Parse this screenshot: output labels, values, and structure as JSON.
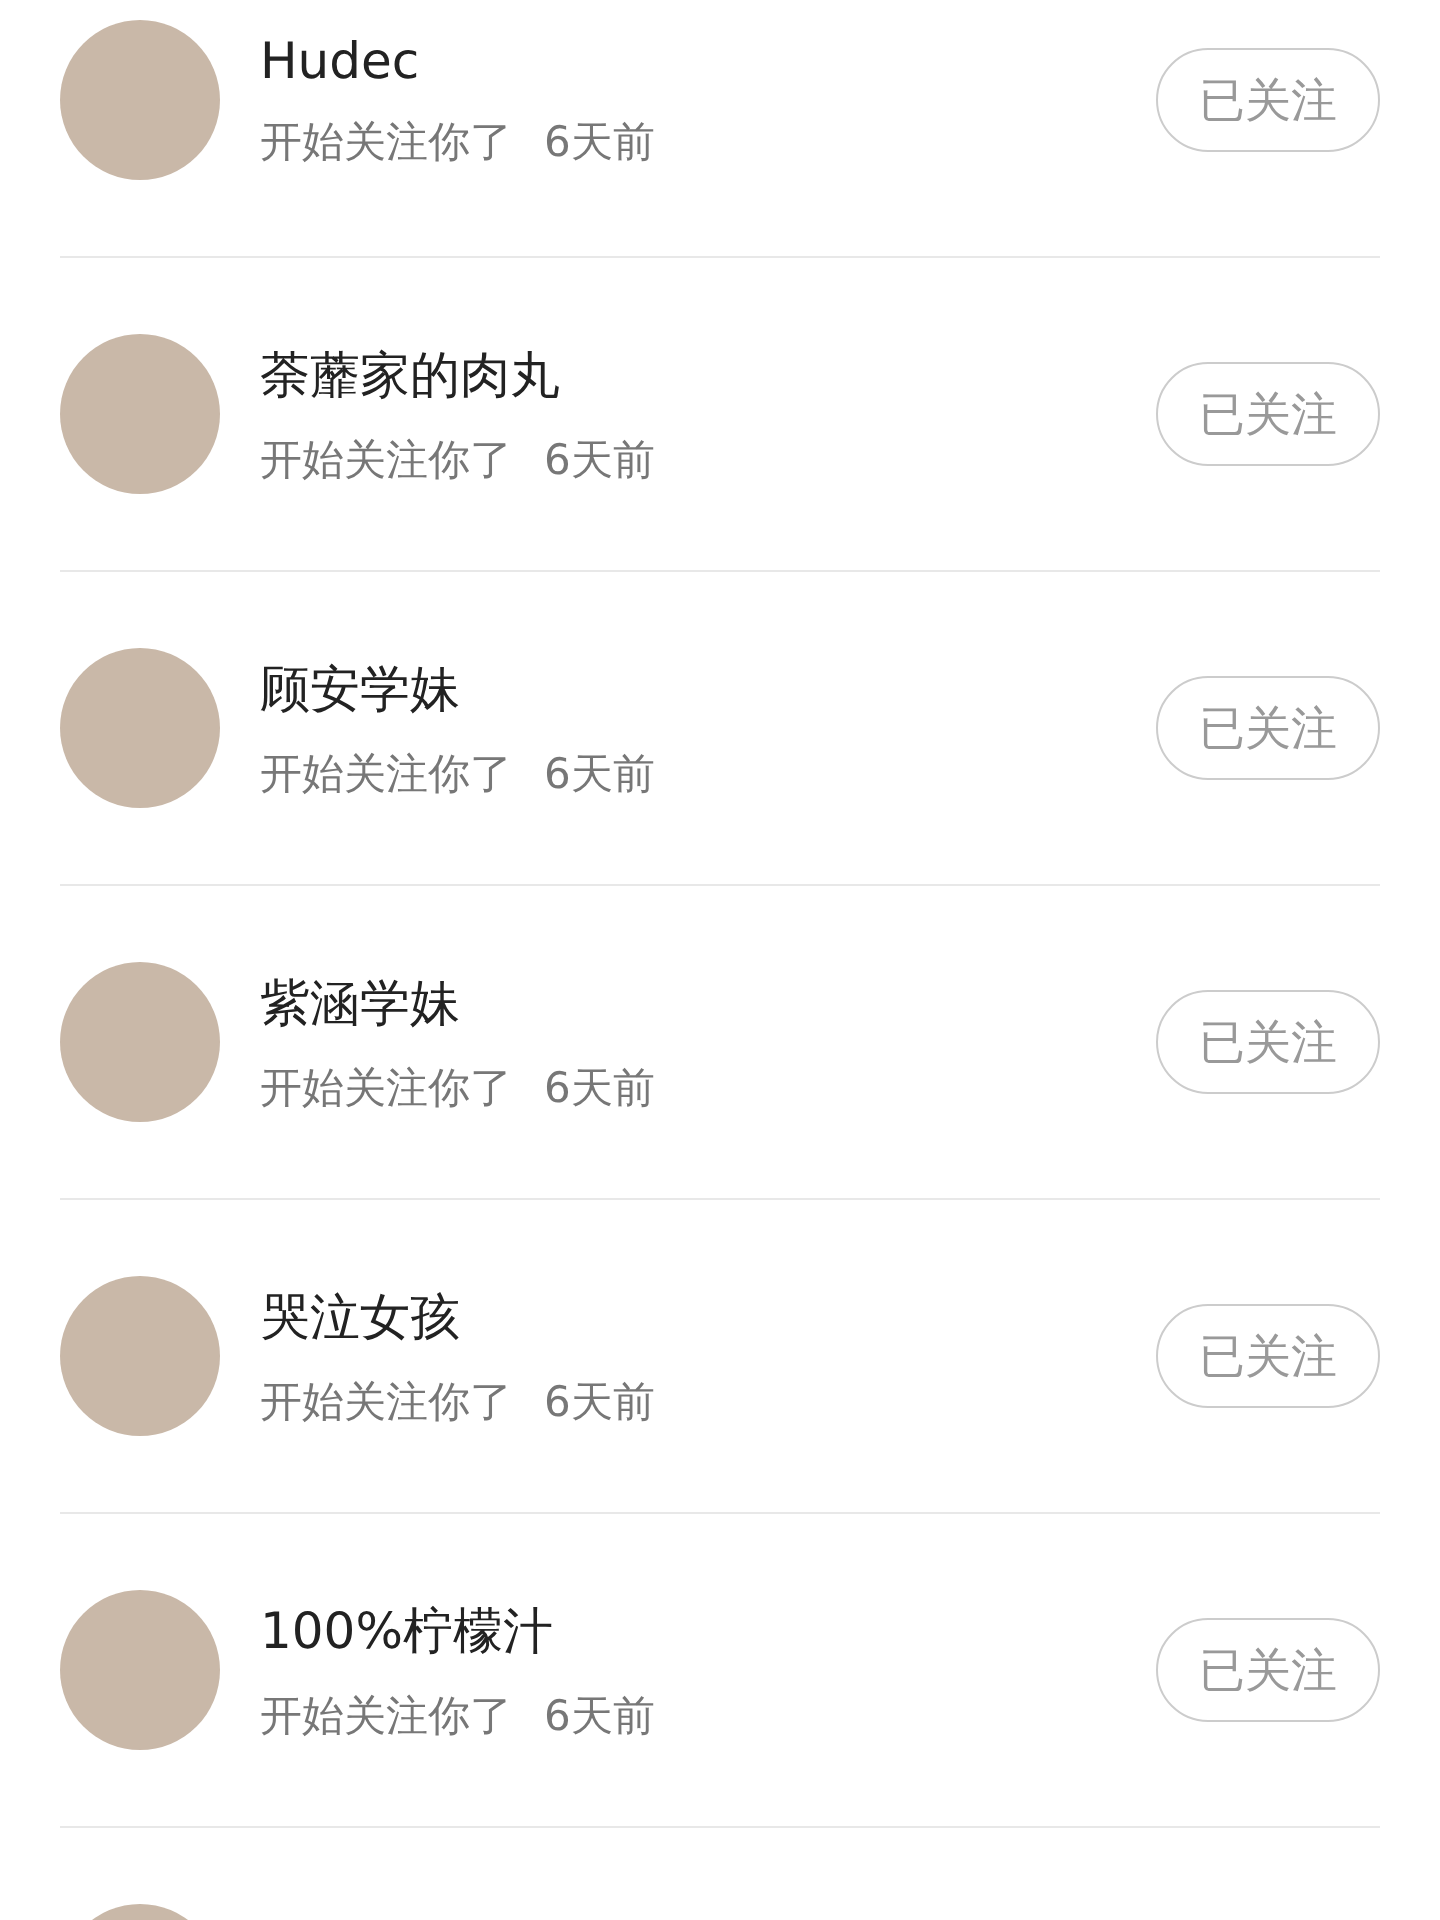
{
  "followers": [
    {
      "kind": "full",
      "name": "Hudec",
      "action": "开始关注你了",
      "time": "6天前",
      "button": "已关注"
    },
    {
      "kind": "full",
      "name": "荼蘼家的肉丸",
      "action": "开始关注你了",
      "time": "6天前",
      "button": "已关注"
    },
    {
      "kind": "full",
      "name": "顾安学妹",
      "action": "开始关注你了",
      "time": "6天前",
      "button": "已关注"
    },
    {
      "kind": "full",
      "name": "紫涵学妹",
      "action": "开始关注你了",
      "time": "6天前",
      "button": "已关注"
    },
    {
      "kind": "full",
      "name": "哭泣女孩",
      "action": "开始关注你了",
      "time": "6天前",
      "button": "已关注"
    },
    {
      "kind": "full",
      "name": "100%柠檬汁",
      "action": "开始关注你了",
      "time": "6天前",
      "button": "已关注"
    },
    {
      "kind": "cut"
    }
  ]
}
